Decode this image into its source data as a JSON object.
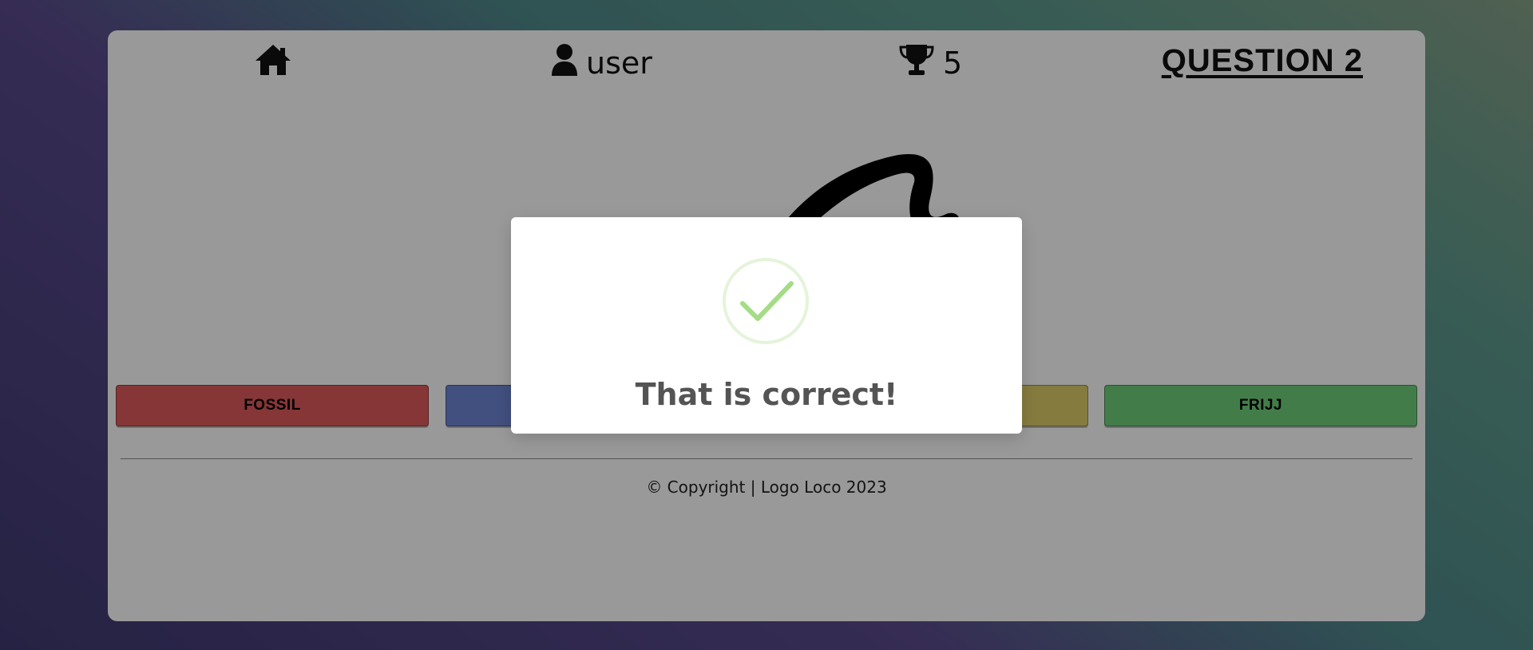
{
  "header": {
    "home_icon": "home-icon",
    "username": "user",
    "user_icon": "user-icon",
    "score": "5",
    "trophy_icon": "trophy-icon",
    "question_label": "QUESTION 2"
  },
  "logo": {
    "icon": "brand-logo-swoosh"
  },
  "answers": [
    {
      "label": "FOSSIL",
      "color": "#e05a5c"
    },
    {
      "label": "",
      "color": "#6f86d6"
    },
    {
      "label": "",
      "color": "#e0cd6a"
    },
    {
      "label": "FRIJJ",
      "color": "#6fd07a"
    }
  ],
  "footer": {
    "text": "© Copyright | Logo Loco 2023"
  },
  "modal": {
    "icon": "success-check-icon",
    "message": "That is correct!",
    "accent_color": "#a5dc86"
  }
}
